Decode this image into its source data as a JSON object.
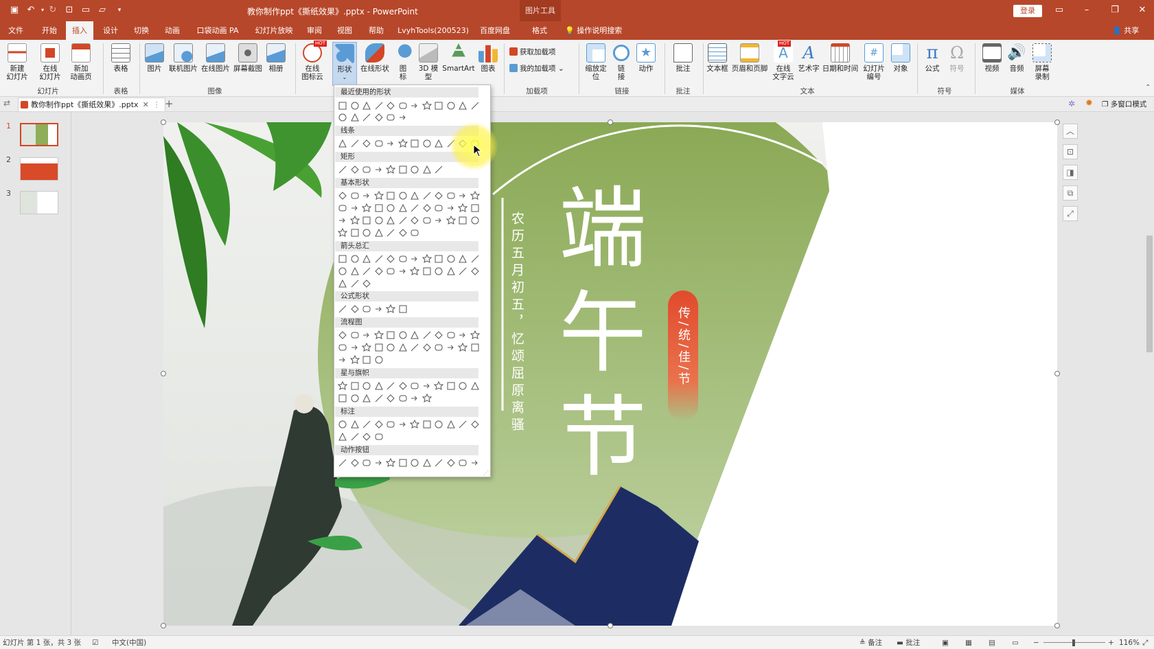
{
  "app": {
    "title": "教你制作ppt《撕纸效果》.pptx - PowerPoint",
    "tool_tab": "图片工具",
    "login": "登录",
    "tell_me": "操作说明搜索",
    "share": "共享"
  },
  "tabs": [
    "文件",
    "开始",
    "插入",
    "设计",
    "切换",
    "动画",
    "口袋动画 PA",
    "幻灯片放映",
    "审阅",
    "视图",
    "帮助",
    "LvyhTools(200523)",
    "百度网盘",
    "格式"
  ],
  "active_tab": "插入",
  "ribbon": {
    "groups": {
      "slides": "幻灯片",
      "tables": "表格",
      "images": "图像",
      "addins": "加载项",
      "links": "链接",
      "comments": "批注",
      "text": "文本",
      "symbols": "符号",
      "media": "媒体"
    },
    "buttons": {
      "new_slide": "新建\n幻灯片",
      "online_slide": "在线\n幻灯片",
      "new_anim": "新加\n动画页",
      "table": "表格",
      "picture": "图片",
      "online_pic": "联机图片",
      "online_pic2": "在线图片",
      "screenshot": "屏幕截图",
      "album": "相册",
      "online_icon": "在线\n图标云",
      "shapes": "形状",
      "online_shapes": "在线形状",
      "icons": "图\n标",
      "model3d": "3D 模\n型",
      "smartart": "SmartArt",
      "chart": "图表",
      "get_addins": "获取加载项",
      "my_addins": "我的加载项",
      "zoom": "缩放定\n位",
      "link": "链\n接",
      "action": "动作",
      "comment": "批注",
      "textbox": "文本框",
      "header_footer": "页眉和页脚",
      "online_text": "在线\n文字云",
      "wordart": "艺术字",
      "datetime": "日期和时间",
      "slide_num": "幻灯片\n编号",
      "object": "对象",
      "equation": "公式",
      "symbol": "符号",
      "video": "视频",
      "audio": "音频",
      "screen_rec": "屏幕\n录制"
    },
    "hot_badge": "HOT"
  },
  "doc_tab": "教你制作ppt《撕纸效果》.pptx",
  "multi_window": "多窗口模式",
  "thumbnails": [
    "1",
    "2",
    "3"
  ],
  "shapes_menu": {
    "sections": [
      "最近使用的形状",
      "线条",
      "矩形",
      "基本形状",
      "箭头总汇",
      "公式形状",
      "流程图",
      "星与旗帜",
      "标注",
      "动作按钮"
    ]
  },
  "slide": {
    "title_chars": [
      "端",
      "午",
      "节"
    ],
    "subtitle": "农历五月初五，忆颂屈原离骚",
    "tag": "传/统/佳/节",
    "colors": {
      "green": "#8fae5a",
      "navy": "#1d2d63",
      "gold": "#d4a84a",
      "red": "#e04a2c"
    }
  },
  "status": {
    "slide_info": "幻灯片 第 1 张，共 3 张",
    "language": "中文(中国)",
    "notes": "备注",
    "comments": "批注",
    "zoom": "116%"
  }
}
